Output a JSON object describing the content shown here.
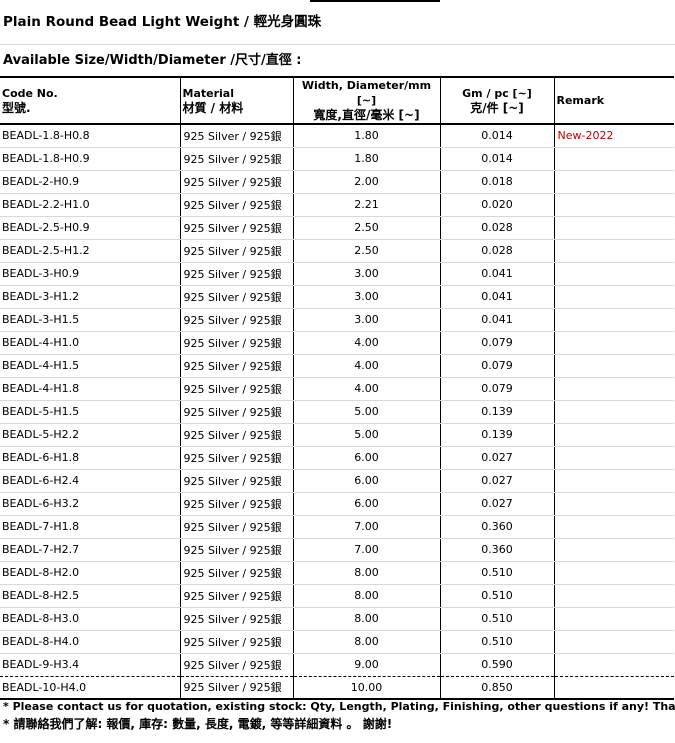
{
  "title": "Plain Round Bead Light Weight / 輕光身圓珠",
  "subtitle": "Available Size/Width/Diameter /尺寸/直徑 :",
  "headers": {
    "code_en": "Code No.",
    "code_zh": "型號.",
    "material_en": "Material",
    "material_zh": "材質  / 材料",
    "width_en": "Width, Diameter/mm [~]",
    "width_zh": "寬度,直徑/毫米 [~]",
    "gm_en": "Gm / pc [~]",
    "gm_zh": "克/件 [~]",
    "remark": "Remark"
  },
  "rows": [
    {
      "code": "BEADL-1.8-H0.8",
      "material": "925 Silver / 925銀",
      "width": "1.80",
      "gm": "0.014",
      "remark": "New-2022"
    },
    {
      "code": "BEADL-1.8-H0.9",
      "material": "925 Silver / 925銀",
      "width": "1.80",
      "gm": "0.014",
      "remark": ""
    },
    {
      "code": "BEADL-2-H0.9",
      "material": "925 Silver / 925銀",
      "width": "2.00",
      "gm": "0.018",
      "remark": ""
    },
    {
      "code": "BEADL-2.2-H1.0",
      "material": "925 Silver / 925銀",
      "width": "2.21",
      "gm": "0.020",
      "remark": ""
    },
    {
      "code": "BEADL-2.5-H0.9",
      "material": "925 Silver / 925銀",
      "width": "2.50",
      "gm": "0.028",
      "remark": ""
    },
    {
      "code": "BEADL-2.5-H1.2",
      "material": "925 Silver / 925銀",
      "width": "2.50",
      "gm": "0.028",
      "remark": ""
    },
    {
      "code": "BEADL-3-H0.9",
      "material": "925 Silver / 925銀",
      "width": "3.00",
      "gm": "0.041",
      "remark": ""
    },
    {
      "code": "BEADL-3-H1.2",
      "material": "925 Silver / 925銀",
      "width": "3.00",
      "gm": "0.041",
      "remark": ""
    },
    {
      "code": "BEADL-3-H1.5",
      "material": "925 Silver / 925銀",
      "width": "3.00",
      "gm": "0.041",
      "remark": ""
    },
    {
      "code": "BEADL-4-H1.0",
      "material": "925 Silver / 925銀",
      "width": "4.00",
      "gm": "0.079",
      "remark": ""
    },
    {
      "code": "BEADL-4-H1.5",
      "material": "925 Silver / 925銀",
      "width": "4.00",
      "gm": "0.079",
      "remark": ""
    },
    {
      "code": "BEADL-4-H1.8",
      "material": "925 Silver / 925銀",
      "width": "4.00",
      "gm": "0.079",
      "remark": ""
    },
    {
      "code": "BEADL-5-H1.5",
      "material": "925 Silver / 925銀",
      "width": "5.00",
      "gm": "0.139",
      "remark": ""
    },
    {
      "code": "BEADL-5-H2.2",
      "material": "925 Silver / 925銀",
      "width": "5.00",
      "gm": "0.139",
      "remark": ""
    },
    {
      "code": "BEADL-6-H1.8",
      "material": "925 Silver / 925銀",
      "width": "6.00",
      "gm": "0.027",
      "remark": ""
    },
    {
      "code": "BEADL-6-H2.4",
      "material": "925 Silver / 925銀",
      "width": "6.00",
      "gm": "0.027",
      "remark": ""
    },
    {
      "code": "BEADL-6-H3.2",
      "material": "925 Silver / 925銀",
      "width": "6.00",
      "gm": "0.027",
      "remark": ""
    },
    {
      "code": "BEADL-7-H1.8",
      "material": "925 Silver / 925銀",
      "width": "7.00",
      "gm": "0.360",
      "remark": ""
    },
    {
      "code": "BEADL-7-H2.7",
      "material": "925 Silver / 925銀",
      "width": "7.00",
      "gm": "0.360",
      "remark": ""
    },
    {
      "code": "BEADL-8-H2.0",
      "material": "925 Silver / 925銀",
      "width": "8.00",
      "gm": "0.510",
      "remark": ""
    },
    {
      "code": "BEADL-8-H2.5",
      "material": "925 Silver / 925銀",
      "width": "8.00",
      "gm": "0.510",
      "remark": ""
    },
    {
      "code": "BEADL-8-H3.0",
      "material": "925 Silver / 925銀",
      "width": "8.00",
      "gm": "0.510",
      "remark": ""
    },
    {
      "code": "BEADL-8-H4.0",
      "material": "925 Silver / 925銀",
      "width": "8.00",
      "gm": "0.510",
      "remark": ""
    },
    {
      "code": "BEADL-9-H3.4",
      "material": "925 Silver / 925銀",
      "width": "9.00",
      "gm": "0.590",
      "remark": ""
    },
    {
      "code": "BEADL-10-H4.0",
      "material": "925 Silver / 925銀",
      "width": "10.00",
      "gm": "0.850",
      "remark": ""
    }
  ],
  "notes": {
    "en": "* Please contact us for quotation, existing stock: Qty, Length, Plating, Finishing, other questions if any! Thanks,",
    "zh": "* 請聯絡我們了解: 報價, 庫存: 數量, 長度, 電鍍, 等等詳細資料 。 謝謝!"
  },
  "colors": {
    "remark_text": "#c00000",
    "grid_light": "#d9d9d9"
  }
}
